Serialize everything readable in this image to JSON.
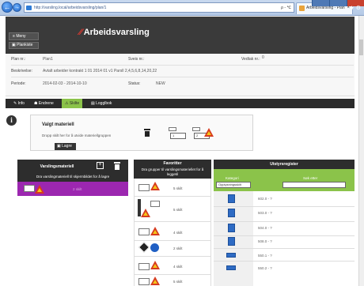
{
  "browser": {
    "url": "http://varsling.local/arbeidsvarsling/plan/1",
    "search_hint": "ρ - ℃",
    "tab_title": "Arbeidsvarsling - Plan",
    "tab_close": "×",
    "back_glyph": "←",
    "forward_glyph": "→",
    "chrome_icons": "⌂ ★ ⚙"
  },
  "header": {
    "menu_label": "Meny",
    "sub_label": "Plankiste",
    "logo_mark": "⁄⁄",
    "app_title": "Arbeidsvarsling"
  },
  "plan": {
    "plan_nr_label": "Plan nr.:",
    "plan_nr_value": "Plan1",
    "sveis_label": "Sveis nr.:",
    "vedtak_label": "Vedtak nr.:",
    "vedtak_value": "0",
    "beskrivelse_label": "Beskrivelse:",
    "beskrivelse_value": "Avtalt arbeider kontrakt 1 01 2014 01 v1  Parsll 2,4,5,6,8,14,20,22",
    "periode_label": "Periode:",
    "periode_value": "2014-02-03 - 2014-10-10",
    "status_label": "Status:",
    "status_value": "NEW"
  },
  "nav": {
    "items": [
      {
        "label": "Info"
      },
      {
        "label": "Endrene"
      },
      {
        "label": "Skilte"
      },
      {
        "label": "Logglbok"
      }
    ]
  },
  "valgt": {
    "title": "Valgt materiell",
    "hint": "Dropp skilt her for å utvide materiellgruppen",
    "lagre_label": "Lagre",
    "count1": "1",
    "count2": "2"
  },
  "varsling": {
    "title": "Varslingsmateriell",
    "subtitle": "Dra varslingmateriell til skjermbildet for å lagre",
    "row_text": "2 skilt"
  },
  "favoritter": {
    "title": "Favoritter",
    "subtitle": "Dra grupper til varslingsmateriellet for å leggetil",
    "rows": [
      {
        "count": "5 skilt"
      },
      {
        "count": "5 skilt"
      },
      {
        "count": "4 skilt"
      },
      {
        "count": "2 skilt"
      },
      {
        "count": "4 skilt"
      },
      {
        "count": "5 skilt"
      }
    ]
  },
  "utstyr": {
    "title": "Utstyrsregister",
    "kategori_label": "Kategori",
    "sok_label": "Søk etter",
    "kategori_value": "Opplysningsskilt",
    "rows": [
      {
        "code": "602.0 - ?"
      },
      {
        "code": "503.0 - ?"
      },
      {
        "code": "504.0 - ?"
      },
      {
        "code": "508.0 - ?"
      },
      {
        "code": "550.1 - ?"
      },
      {
        "code": "550.2 - ?"
      }
    ]
  },
  "colors": {
    "accent_green": "#8bc34a",
    "accent_purple": "#9c27b0",
    "header_dark": "#3a3a3a",
    "warning_red": "#d63b1f",
    "sign_blue": "#2e6bc4"
  }
}
